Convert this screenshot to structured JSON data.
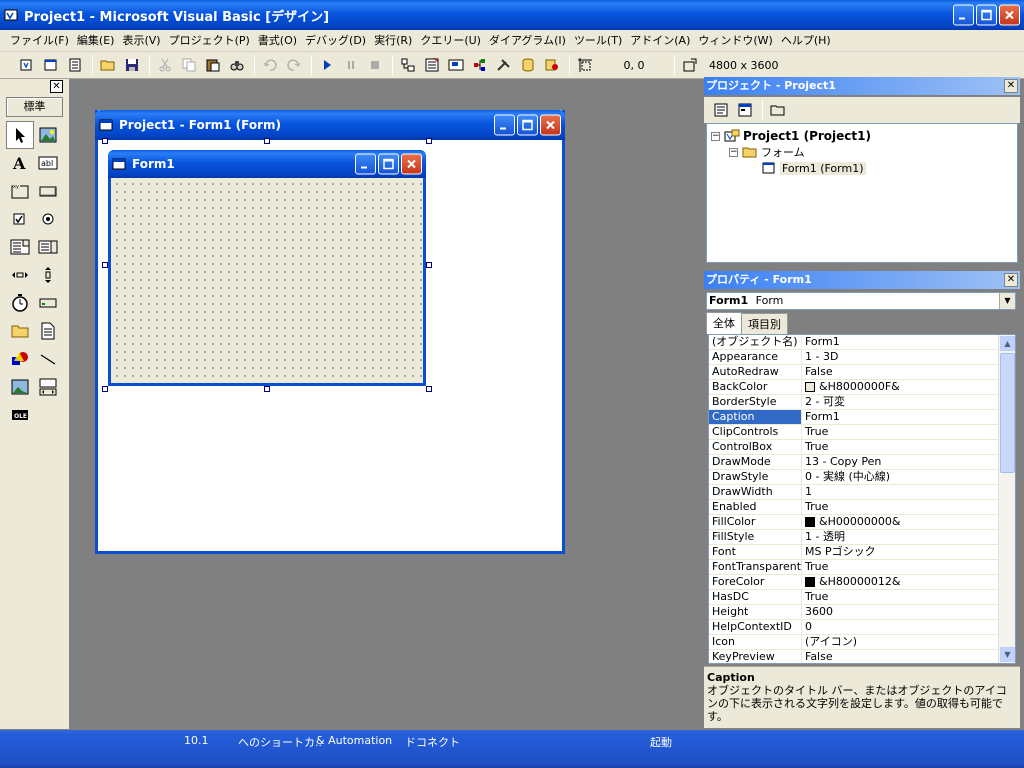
{
  "app": {
    "title": "Project1 - Microsoft Visual Basic [デザイン]"
  },
  "menu": [
    "ファイル(F)",
    "編集(E)",
    "表示(V)",
    "プロジェクト(P)",
    "書式(O)",
    "デバッグ(D)",
    "実行(R)",
    "クエリー(U)",
    "ダイアグラム(I)",
    "ツール(T)",
    "アドイン(A)",
    "ウィンドウ(W)",
    "ヘルプ(H)"
  ],
  "toolbar": {
    "position": "0, 0",
    "size": "4800 x 3600"
  },
  "toolbox": {
    "tab_label": "標準",
    "tools": [
      "pointer-tool",
      "picturebox-tool",
      "label-tool",
      "textbox-tool",
      "frame-tool",
      "commandbutton-tool",
      "checkbox-tool",
      "optionbutton-tool",
      "combobox-tool",
      "listbox-tool",
      "hscrollbar-tool",
      "vscrollbar-tool",
      "timer-tool",
      "drivelistbox-tool",
      "dirlistbox-tool",
      "filelistbox-tool",
      "shape-tool",
      "line-tool",
      "image-tool",
      "data-tool",
      "ole-tool"
    ]
  },
  "designer": {
    "title": "Project1 - Form1 (Form)",
    "form_caption": "Form1"
  },
  "project_pane": {
    "title": "プロジェクト - Project1",
    "tree": {
      "project": "Project1 (Project1)",
      "folder": "フォーム",
      "form": "Form1 (Form1)"
    }
  },
  "properties_pane": {
    "title": "プロパティ - Form1",
    "object_name": "Form1",
    "object_type": "Form",
    "tabs": [
      "全体",
      "項目別"
    ],
    "active_tab": "全体",
    "rows": [
      {
        "name": "(オブジェクト名)",
        "value": "Form1"
      },
      {
        "name": "Appearance",
        "value": "1 - 3D"
      },
      {
        "name": "AutoRedraw",
        "value": "False"
      },
      {
        "name": "BackColor",
        "value": "&H8000000F&",
        "swatch": "#ece9d8"
      },
      {
        "name": "BorderStyle",
        "value": "2 - 可変"
      },
      {
        "name": "Caption",
        "value": "Form1",
        "selected": true
      },
      {
        "name": "ClipControls",
        "value": "True"
      },
      {
        "name": "ControlBox",
        "value": "True"
      },
      {
        "name": "DrawMode",
        "value": "13 - Copy Pen"
      },
      {
        "name": "DrawStyle",
        "value": "0 - 実線 (中心線)"
      },
      {
        "name": "DrawWidth",
        "value": "1"
      },
      {
        "name": "Enabled",
        "value": "True"
      },
      {
        "name": "FillColor",
        "value": "&H00000000&",
        "swatch": "#000000"
      },
      {
        "name": "FillStyle",
        "value": "1 - 透明"
      },
      {
        "name": "Font",
        "value": "MS Pゴシック"
      },
      {
        "name": "FontTransparent",
        "value": "True"
      },
      {
        "name": "ForeColor",
        "value": "&H80000012&",
        "swatch": "#000000"
      },
      {
        "name": "HasDC",
        "value": "True"
      },
      {
        "name": "Height",
        "value": "3600"
      },
      {
        "name": "HelpContextID",
        "value": "0"
      },
      {
        "name": "Icon",
        "value": "(アイコン)"
      },
      {
        "name": "KeyPreview",
        "value": "False"
      }
    ],
    "description_title": "Caption",
    "description_text": "オブジェクトのタイトル バー、またはオブジェクトのアイコンの下に表示される文字列を設定します。値の取得も可能です。"
  },
  "taskbar": {
    "items": [
      "10.1",
      "へのショートカ..",
      "& Automation",
      "ドコネクト",
      "起動"
    ]
  },
  "colors": {
    "title_blue": "#0a4fd0",
    "chrome": "#ece9d8",
    "selection": "#316ac5"
  }
}
